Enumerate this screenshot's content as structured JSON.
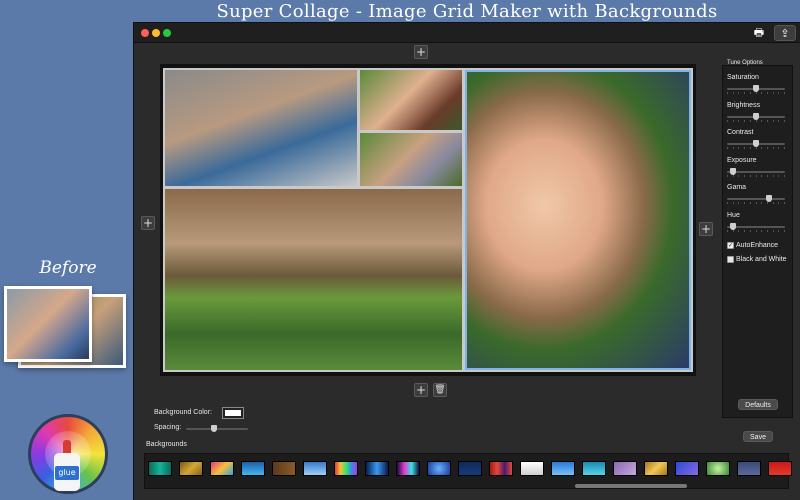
{
  "promo": {
    "headline": "Super Collage - Image Grid Maker with Backgrounds",
    "before_label": "Before",
    "logo_text": "glue"
  },
  "window": {
    "traffic_lights": [
      "#ff5f57",
      "#ffbd2e",
      "#28c840"
    ],
    "toolbar": [
      {
        "name": "print-button",
        "icon": "printer-icon",
        "glyph": "🖶"
      },
      {
        "name": "share-button",
        "icon": "share-icon",
        "glyph": "⇪"
      }
    ]
  },
  "canvas": {
    "add_glyph": "+",
    "delete_glyph": "🗑",
    "selected_border_color": "#7fb3e8"
  },
  "tune": {
    "title": "Tune Options",
    "sliders": [
      {
        "label": "Saturation",
        "value": 0.5
      },
      {
        "label": "Brightness",
        "value": 0.5
      },
      {
        "label": "Contrast",
        "value": 0.5
      },
      {
        "label": "Exposure",
        "value": 0.05
      },
      {
        "label": "Gama",
        "value": 0.75
      },
      {
        "label": "Hue",
        "value": 0.05
      }
    ],
    "checkboxes": [
      {
        "label": "AutoEnhance",
        "checked": true
      },
      {
        "label": "Black and White",
        "checked": false
      }
    ],
    "defaults_button": "Defaults",
    "save_button": "Save"
  },
  "controls": {
    "background_color_label": "Background Color:",
    "background_color": "#ffffff",
    "spacing_label": "Spacing:",
    "spacing_value": 0.45,
    "backgrounds_label": "Backgrounds"
  },
  "backgrounds": [
    {
      "name": "teal-gradient",
      "css": "linear-gradient(90deg,#0a6b5a,#19b39a,#0a6b5a)"
    },
    {
      "name": "gold-texture",
      "css": "linear-gradient(135deg,#7a5a12,#d4a63a,#8a6418)"
    },
    {
      "name": "color-splash",
      "css": "linear-gradient(135deg,#e23b7a,#f4c13a,#3aa0e2)"
    },
    {
      "name": "blue-wave",
      "css": "linear-gradient(180deg,#1e5fa8,#46b4f0)"
    },
    {
      "name": "brown-wood",
      "css": "linear-gradient(90deg,#5c3a1a,#8a5a2a)"
    },
    {
      "name": "light-blue-sky",
      "css": "linear-gradient(180deg,#3a78c8,#9fd0f5)"
    },
    {
      "name": "rainbow-bars",
      "css": "linear-gradient(90deg,#e23b3b,#f4c13a,#3ae26a,#3a8ae2,#a83ae2)"
    },
    {
      "name": "blue-glow-lines",
      "css": "linear-gradient(90deg,#0a1a4a,#3a9af0,#0a1a4a)"
    },
    {
      "name": "neon-streaks",
      "css": "linear-gradient(90deg,#1a0a3a,#e23bd0,#3ae2e2,#1a0a3a)"
    },
    {
      "name": "blue-bokeh",
      "css": "radial-gradient(circle,#6ab4ff,#1a3a9a)"
    },
    {
      "name": "navy-plain",
      "css": "linear-gradient(180deg,#0e2a5a,#1a3a7a)"
    },
    {
      "name": "red-stripes",
      "css": "linear-gradient(90deg,#a01a1a,#e24a3a,#4a1a6a,#e24a3a)"
    },
    {
      "name": "white-glow",
      "css": "linear-gradient(180deg,#ffffff,#cfcfcf)"
    },
    {
      "name": "azure-gradient",
      "css": "linear-gradient(180deg,#2a7ad8,#7ac0f5)"
    },
    {
      "name": "cyan-gradient",
      "css": "linear-gradient(180deg,#1a8ab0,#5ad0e8)"
    },
    {
      "name": "lavender-texture",
      "css": "linear-gradient(135deg,#8a6ab0,#c8a8e0)"
    },
    {
      "name": "gold-shimmer",
      "css": "linear-gradient(135deg,#a8761a,#f0c85a,#a8761a)"
    },
    {
      "name": "blue-purple",
      "css": "linear-gradient(135deg,#2a4ad8,#8a6ae0)"
    },
    {
      "name": "green-glow",
      "css": "radial-gradient(circle,#c8f0a0,#3a8a3a)"
    },
    {
      "name": "slate-blue",
      "css": "linear-gradient(180deg,#3a4a7a,#5a6a9a)"
    },
    {
      "name": "red-plain",
      "css": "linear-gradient(180deg,#c81a1a,#e23a2a)"
    }
  ]
}
